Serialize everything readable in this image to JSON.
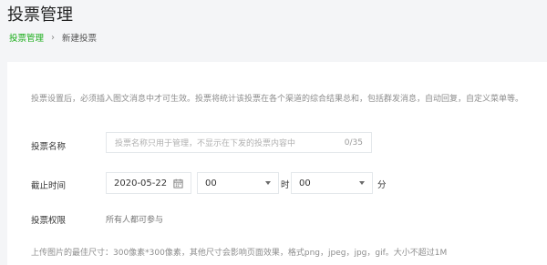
{
  "header": {
    "title": "投票管理"
  },
  "breadcrumb": {
    "parent": "投票管理",
    "separator": "›",
    "current": "新建投票"
  },
  "form": {
    "notice": "投票设置后，必须插入图文消息中才可生效。投票将统计该投票在各个渠道的综合结果总和，包括群发消息，自动回复，自定义菜单等。",
    "name": {
      "label": "投票名称",
      "placeholder": "投票名称只用于管理，不显示在下发的投票内容中",
      "counter": "0/35"
    },
    "deadline": {
      "label": "截止时间",
      "date": "2020-05-22",
      "hour": "00",
      "hour_unit": "时",
      "minute": "00",
      "minute_unit": "分"
    },
    "permission": {
      "label": "投票权限",
      "value": "所有人都可参与"
    },
    "upload_hint": "上传图片的最佳尺寸：300像素*300像素，其他尺寸会影响页面效果，格式png，jpeg，jpg，gif。大小不超过1M"
  },
  "icons": {
    "calendar": "calendar-icon",
    "dropdown": "chevron-down-icon"
  },
  "colors": {
    "accent": "#1aad19",
    "page_bg": "#f4f5f7"
  }
}
